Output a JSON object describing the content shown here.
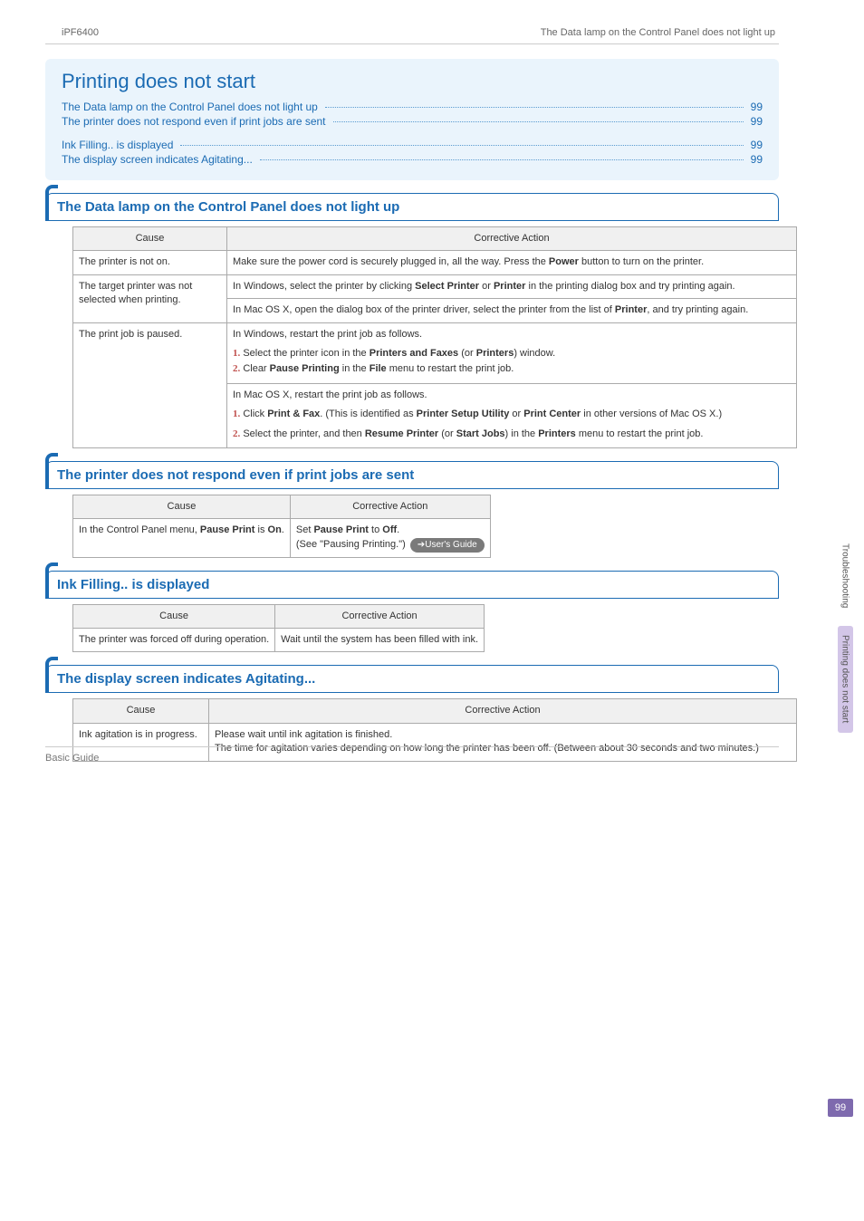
{
  "header": {
    "left": "iPF6400",
    "right": "The Data lamp on the Control Panel does not light up"
  },
  "banner": {
    "title": "Printing does not start",
    "toc": [
      {
        "label": "The Data lamp on the Control Panel does not light up",
        "pg": "99"
      },
      {
        "label": "The printer does not respond even if print jobs are sent",
        "pg": "99"
      },
      {
        "gap": true
      },
      {
        "label": "Ink Filling.. is displayed",
        "pg": "99"
      },
      {
        "label": "The display screen indicates Agitating...",
        "pg": "99"
      }
    ]
  },
  "sections": {
    "s1": {
      "title": "The Data lamp on the Control Panel does not light up",
      "headers": {
        "cause": "Cause",
        "action": "Corrective Action"
      },
      "rows": {
        "r1": {
          "cause": "The printer is not on.",
          "action": "Make sure the power cord is securely plugged in, all the way. Press the <b>Power</b> button to turn on the printer."
        },
        "r2": {
          "cause": "The target printer was not selected when printing.",
          "action_a": "In Windows, select the printer by clicking <b>Select Printer</b> or <b>Printer</b> in the printing dialog box and try printing again.",
          "action_b": "In Mac OS X, open the dialog box of the printer driver, select the printer from the list of <b>Printer</b>, and try printing again."
        },
        "r3": {
          "cause": "The print job is paused.",
          "win_intro": "In Windows, restart the print job as follows.",
          "win_1": "Select the printer icon in the <b>Printers and Faxes</b> (or <b>Printers</b>) window.",
          "win_2": "Clear <b>Pause Printing</b> in the <b>File</b> menu to restart the print job.",
          "mac_intro": "In Mac OS X, restart the print job as follows.",
          "mac_1": "Click <b>Print & Fax</b>. (This is identified as <b>Printer Setup Utility</b> or <b>Print Center</b> in other versions of Mac OS X.)",
          "mac_2": "Select the printer, and then <b>Resume Printer</b> (or <b>Start Jobs</b>) in the <b>Printers</b> menu to restart the print job."
        }
      }
    },
    "s2": {
      "title": "The printer does not respond even if print jobs are sent",
      "headers": {
        "cause": "Cause",
        "action": "Corrective Action"
      },
      "rows": {
        "r1": {
          "cause": "In the Control Panel menu, <b>Pause Print</b> is <b>On</b>.",
          "action_line1": "Set <b>Pause Print</b> to <b>Off</b>.",
          "action_line2": "(See \"Pausing Printing.\")",
          "badge": "➔User's Guide"
        }
      }
    },
    "s3": {
      "title": "Ink Filling.. is displayed",
      "headers": {
        "cause": "Cause",
        "action": "Corrective Action"
      },
      "rows": {
        "r1": {
          "cause": "The printer was forced off during operation.",
          "action": "Wait until the system has been filled with ink."
        }
      }
    },
    "s4": {
      "title": "The display screen indicates Agitating...",
      "headers": {
        "cause": "Cause",
        "action": "Corrective Action"
      },
      "rows": {
        "r1": {
          "cause": "Ink agitation is in progress.",
          "action": "Please wait until ink agitation is finished.<br>The time for agitation varies depending on how long the printer has been off. (Between about 30 seconds and two minutes.)"
        }
      }
    }
  },
  "side_tabs": {
    "t1": "Troubleshooting",
    "t2": "Printing does not start"
  },
  "page_number": "99",
  "footer": "Basic Guide"
}
